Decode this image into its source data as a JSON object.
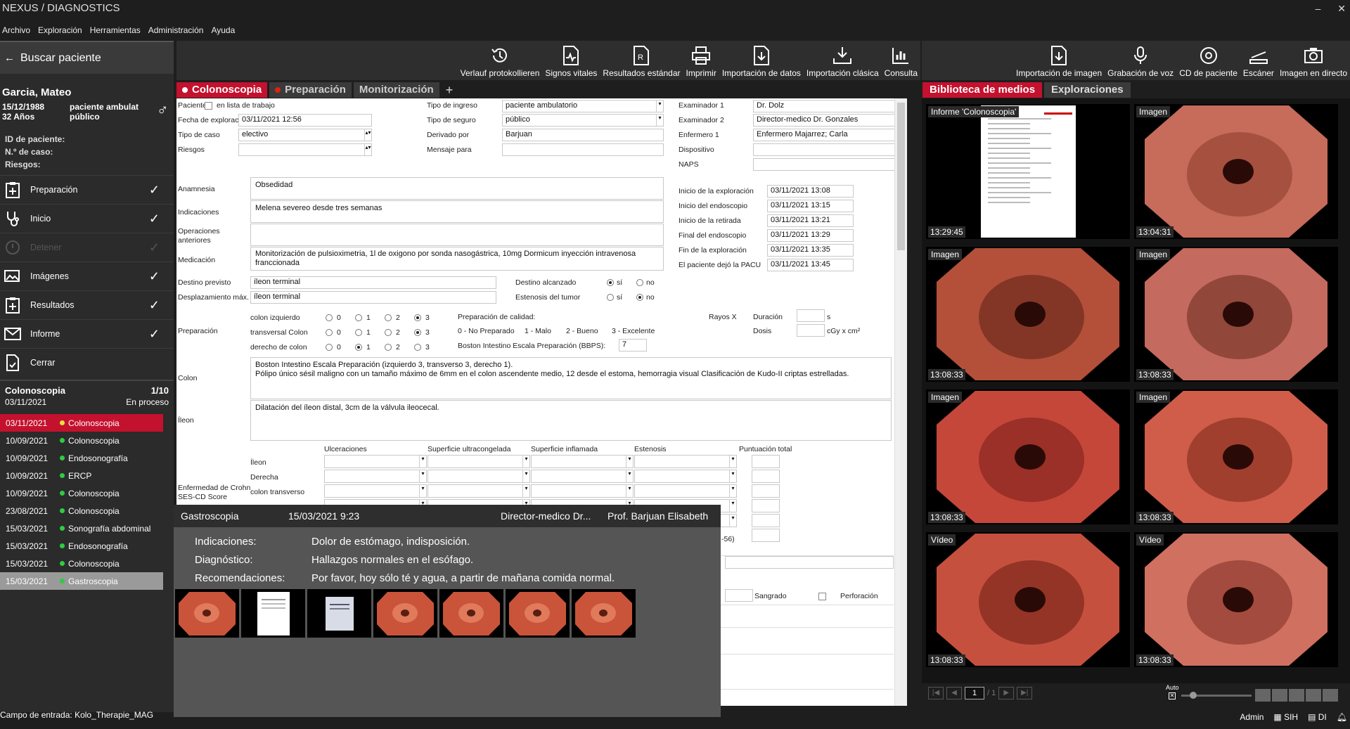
{
  "app": {
    "title": "NEXUS / DIAGNOSTICS",
    "min": "–",
    "close": "✕"
  },
  "menu": [
    "Archivo",
    "Exploración",
    "Herramientas",
    "Administración",
    "Ayuda"
  ],
  "sidebar": {
    "search_label": "Buscar paciente",
    "patient": {
      "name": "Garcia, Mateo",
      "dob": "15/12/1988",
      "age": "32 Años",
      "type1": "paciente ambulat",
      "type2": "público",
      "gender_icon": "male-icon"
    },
    "ids": [
      "ID de paciente:",
      "N.º de caso:",
      "Riesgos:"
    ],
    "steps": [
      {
        "label": "Preparación",
        "icon": "clipboard-plus-icon",
        "done": "✓"
      },
      {
        "label": "Inicio",
        "icon": "stethoscope-icon",
        "done": "✓"
      },
      {
        "label": "Detener",
        "icon": "stop-icon",
        "done": "✓"
      },
      {
        "label": "Imágenes",
        "icon": "images-icon",
        "done": "✓"
      },
      {
        "label": "Resultados",
        "icon": "clipboard-plus-icon",
        "done": "✓"
      },
      {
        "label": "Informe",
        "icon": "envelope-icon",
        "done": "✓"
      },
      {
        "label": "Cerrar",
        "icon": "document-icon",
        "done": ""
      }
    ],
    "case": {
      "title": "Colonoscopia",
      "count": "1/10",
      "date": "03/11/2021",
      "status": "En proceso"
    },
    "cases": [
      {
        "date": "03/11/2021",
        "name": "Colonoscopia",
        "dot": "#e8e33a"
      },
      {
        "date": "10/09/2021",
        "name": "Colonoscopia",
        "dot": "#2ecc40"
      },
      {
        "date": "10/09/2021",
        "name": "Endosonografía",
        "dot": "#2ecc40"
      },
      {
        "date": "10/09/2021",
        "name": "ERCP",
        "dot": "#2ecc40"
      },
      {
        "date": "10/09/2021",
        "name": "Colonoscopia",
        "dot": "#2ecc40"
      },
      {
        "date": "23/08/2021",
        "name": "Colonoscopia",
        "dot": "#2ecc40"
      },
      {
        "date": "15/03/2021",
        "name": "Sonografía abdominal",
        "dot": "#2ecc40"
      },
      {
        "date": "15/03/2021",
        "name": "Endosonografía",
        "dot": "#2ecc40"
      },
      {
        "date": "15/03/2021",
        "name": "Colonoscopia",
        "dot": "#2ecc40"
      },
      {
        "date": "15/03/2021",
        "name": "Gastroscopia",
        "dot": "#2ecc40"
      }
    ]
  },
  "toolbar_main": [
    "Verlauf protokollieren",
    "Signos vitales",
    "Resultados estándar",
    "Imprimir",
    "Importación de datos",
    "Importación clásica",
    "Consulta"
  ],
  "toolbar_media": [
    "Importación de imagen",
    "Grabación de voz",
    "CD de paciente",
    "Escáner",
    "Imagen en directo"
  ],
  "tabs": [
    "Colonoscopia",
    "Preparación",
    "Monitorización",
    "+"
  ],
  "form": {
    "paciente": "Paciente",
    "en_lista": "en lista de trabajo",
    "fecha_label": "Fecha de exploración",
    "fecha": "03/11/2021  12:56",
    "tipo_caso_label": "Tipo de caso",
    "tipo_caso": "electivo",
    "riesgos_label": "Riesgos",
    "ingreso_label": "Tipo de ingreso",
    "ingreso": "paciente ambulatorio",
    "seguro_label": "Tipo de seguro",
    "seguro": "público",
    "derivado_label": "Derivado por",
    "derivado": "Barjuan",
    "mensaje_label": "Mensaje para",
    "ex1_label": "Examinador 1",
    "ex1": "Dr. Dolz",
    "ex2_label": "Examinador 2",
    "ex2": "Director-medico Dr. Gonzales",
    "enf_label": "Enfermero 1",
    "enf": "Enfermero Majarrez; Carla",
    "disp_label": "Dispositivo",
    "naps_label": "NAPS",
    "anamnesia_label": "Anamnesia",
    "anamnesia": "Obsedidad",
    "indic_label": "Indicaciones",
    "indic": "Melena severeo desde tres semanas",
    "oper_label1": "Operaciones",
    "oper_label2": "anteriores",
    "medic_label": "Medicación",
    "medic": "Monitorización de pulsioximetria, 1l de oxigono por sonda nasogástrica, 10mg Dormicum inyección intravenosa franccionada",
    "times": [
      {
        "label": "Inicio de la exploración",
        "val": "03/11/2021  13:08"
      },
      {
        "label": "Inicio del endoscopio",
        "val": "03/11/2021  13:15"
      },
      {
        "label": "Inicio de la retirada",
        "val": "03/11/2021  13:21"
      },
      {
        "label": "Final del endoscopio",
        "val": "03/11/2021  13:29"
      },
      {
        "label": "Fin de la exploración",
        "val": "03/11/2021  13:35"
      },
      {
        "label": "El paciente dejó la PACU",
        "val": "03/11/2021  13:45"
      }
    ],
    "destino_label": "Destino previsto",
    "destino": "íleon terminal",
    "despl_label": "Desplazamiento máx.",
    "despl": "íleon terminal",
    "alcanzado_label": "Destino alcanzado",
    "estenosis_label": "Estenosis del tumor",
    "si": "sí",
    "no": "no",
    "prep_label": "Preparación",
    "prep_rows": [
      "colon izquierdo",
      "transversal Colon",
      "derecho de colon"
    ],
    "prep_nums": [
      "0",
      "1",
      "2",
      "3"
    ],
    "calidad_label": "Preparación de calidad:",
    "calidad_scale": [
      "0 - No Preparado",
      "1 - Malo",
      "2 - Bueno",
      "3 - Excelente"
    ],
    "bbps_label": "Boston Intestino Escala Preparación (BBPS):",
    "bbps": "7",
    "rayos": "Rayos X",
    "duracion": "Duración",
    "dosis": "Dosis",
    "s_unit": "s",
    "dose_unit": "cGy x cm²",
    "colon_label": "Colon",
    "colon_text": "Boston Intestino Escala Preparación (izquierdo 3, transverso 3, derecho 1).\nPólipo único sésil maligno con un tamaño máximo de 6mm en el colon ascendente medio, 12 desde el estoma, hemorragia visual Clasificación de Kudo-II criptas estrelladas.",
    "ileon_label": "Íleon",
    "ileon_text": "Dilatación del íleon distal, 3cm de la válvula ileocecal.",
    "crohn_label1": "Enfermedad de Crohn",
    "crohn_label2": "SES-CD Score",
    "crohn_cols": [
      "Ulceraciones",
      "Superficie ultracongelada",
      "Superficie inflamada",
      "Estenosis",
      "Puntuación total"
    ],
    "crohn_rows": [
      "Íleon",
      "Derecha",
      "colon transverso"
    ],
    "crohn_tail": "-56)",
    "sangrado": "Sangrado",
    "perforacion": "Perforación"
  },
  "popup": {
    "title": "Gastroscopia",
    "date": "15/03/2021 9:23",
    "doctor": "Director-medico Dr...",
    "prof": "Prof.  Barjuan Elisabeth",
    "rows": [
      {
        "k": "Indicaciones:",
        "v": "Dolor de estómago, indisposición."
      },
      {
        "k": "Diagnóstico:",
        "v": "Hallazgos normales en el esófago."
      },
      {
        "k": "Recomendaciones:",
        "v": "Por favor, hoy sólo té y agua, a partir de mañana comida normal."
      }
    ]
  },
  "media_tabs": [
    "Biblioteca de medios",
    "Exploraciones"
  ],
  "media": [
    {
      "label": "Informe 'Colonoscopia'",
      "time": "13:29:45",
      "kind": "doc"
    },
    {
      "label": "Imagen",
      "time": "13:04:31",
      "kind": "img"
    },
    {
      "label": "Imagen",
      "time": "13:08:33",
      "kind": "img"
    },
    {
      "label": "Imagen",
      "time": "13:08:33",
      "kind": "img"
    },
    {
      "label": "Imagen",
      "time": "13:08:33",
      "kind": "img"
    },
    {
      "label": "Imagen",
      "time": "13:08:33",
      "kind": "img"
    },
    {
      "label": "Vídeo",
      "time": "13:08:33",
      "kind": "img"
    },
    {
      "label": "Vídeo",
      "time": "13:08:33",
      "kind": "img"
    }
  ],
  "pager": {
    "page": "1",
    "total": "/ 1",
    "auto": "Auto"
  },
  "status": {
    "input_field": "Campo de entrada: Kolo_Therapie_MAG",
    "user": "Admin",
    "sih": "SIH",
    "di": "DI"
  }
}
